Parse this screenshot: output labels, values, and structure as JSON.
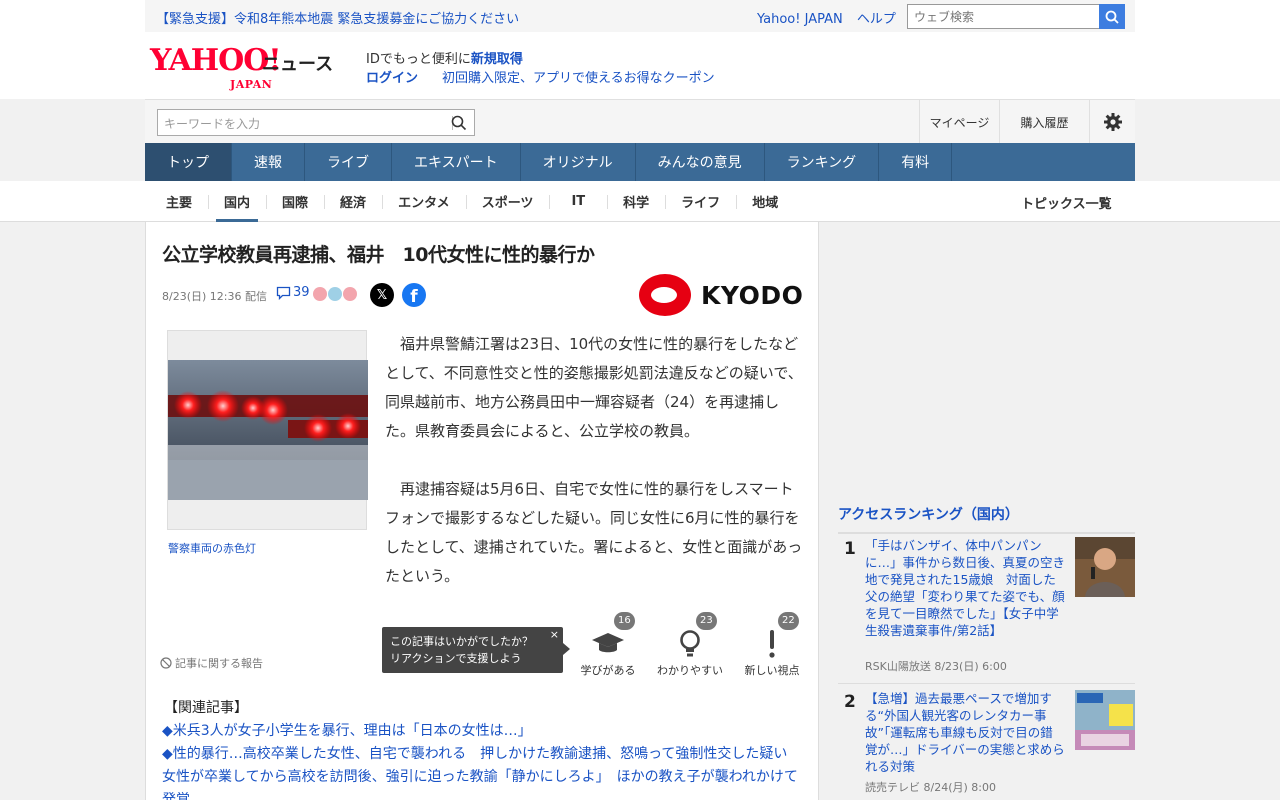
{
  "topbar": {
    "emergency": "【緊急支援】令和8年熊本地震 緊急支援募金にご協力ください",
    "links": [
      "Yahoo! JAPAN",
      "ヘルプ"
    ],
    "search_placeholder": "ウェブ検索"
  },
  "header": {
    "logo_main": "YAHOO!",
    "logo_sub": "JAPAN",
    "logo_news": "ニュース",
    "promo_text": "IDでもっと便利に",
    "promo_register": "新規取得",
    "login": "ログイン",
    "coupon": "初回購入限定、アプリで使えるお得なクーポン"
  },
  "search": {
    "placeholder": "キーワードを入力",
    "mypage": "マイページ",
    "history": "購入履歴"
  },
  "nav": {
    "items": [
      "トップ",
      "速報",
      "ライブ",
      "エキスパート",
      "オリジナル",
      "みんなの意見",
      "ランキング",
      "有料"
    ],
    "active": "トップ"
  },
  "subnav": {
    "items": [
      "主要",
      "国内",
      "国際",
      "経済",
      "エンタメ",
      "スポーツ",
      "IT",
      "科学",
      "ライフ",
      "地域"
    ],
    "active": "国内",
    "topics": "トピックス一覧"
  },
  "article": {
    "title": "公立学校教員再逮捕、福井　10代女性に性的暴行か",
    "datetime": "8/23(日) 12:36",
    "delivery": "配信",
    "comment_count": "39",
    "publisher": "KYODO",
    "sns": {
      "x": "𝕏",
      "facebook": "f"
    },
    "photo_caption": "警察車両の赤色灯",
    "paragraphs": [
      "福井県警鯖江署は23日、10代の女性に性的暴行をしたなどとして、不同意性交と性的姿態撮影処罰法違反などの疑いで、同県越前市、地方公務員田中一輝容疑者（24）を再逮捕した。県教育委員会によると、公立学校の教員。",
      "再逮捕容疑は5月6日、自宅で女性に性的暴行をしスマートフォンで撮影するなどした疑い。同じ女性に6月に性的暴行をしたとして、逮捕されていた。署によると、女性と面識があったという。"
    ],
    "report": "記事に関する報告",
    "tooltip_line1": "この記事はいかがでしたか？",
    "tooltip_line2": "リアクションで支援しよう",
    "tooltip_close": "×",
    "reactions": [
      {
        "label": "学びがある",
        "count": "16"
      },
      {
        "label": "わかりやすい",
        "count": "23"
      },
      {
        "label": "新しい視点",
        "count": "22"
      }
    ],
    "related_heading": "【関連記事】",
    "related": [
      "◆米兵3人が女子小学生を暴行、理由は「日本の女性は…」",
      "◆性的暴行…高校卒業した女性、自宅で襲われる　押しかけた教諭逮捕、怒鳴って強制性交した疑い　女性が卒業してから高校を訪問後、強引に迫った教諭「静かにしろよ」　ほかの教え子が襲われかけて発覚"
    ]
  },
  "ranking": {
    "heading": "アクセスランキング（国内）",
    "items": [
      {
        "no": "1",
        "title": "「手はバンザイ、体中パンパンに…」事件から数日後、真夏の空き地で発見された15歳娘　対面した父の絶望「変わり果てた姿でも、顔を見て一目瞭然でした」【女子中学生殺害遺棄事件/第2話】",
        "source": "RSK山陽放送 8/23(日) 6:00"
      },
      {
        "no": "2",
        "title": "【急増】過去最悪ペースで増加する“外国人観光客のレンタカー事故”「運転席も車線も反対で目の錯覚が…」ドライバーの実態と求められる対策",
        "source": "読売テレビ 8/24(月) 8:00"
      }
    ]
  },
  "colors": {
    "brand_red": "#ff0033",
    "nav_blue": "#3b6a96",
    "link_blue": "#1a53c4",
    "kyodo_red": "#e60012"
  }
}
